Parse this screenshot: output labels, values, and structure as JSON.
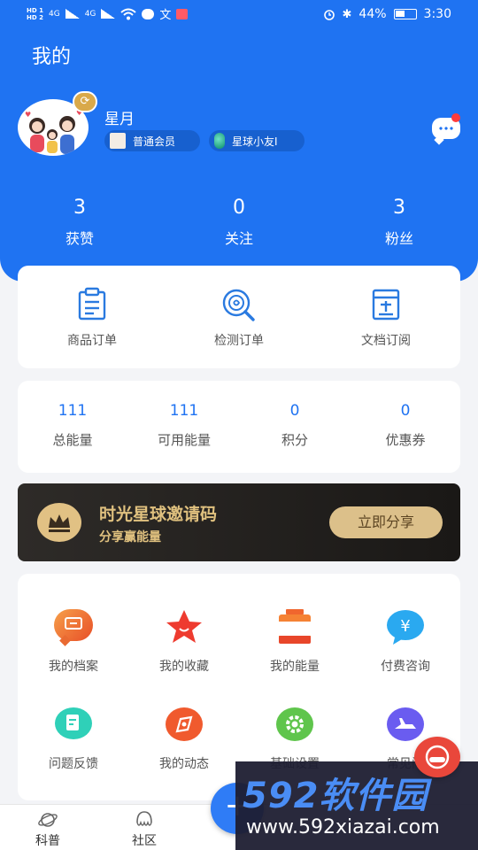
{
  "status_bar": {
    "hd1": "HD 1",
    "hd2": "HD 2",
    "net1": "4G",
    "net2": "4G",
    "battery": "44%",
    "time": "3:30"
  },
  "header": {
    "title": "我的"
  },
  "profile": {
    "name": "星月",
    "tags": [
      {
        "label": "普通会员"
      },
      {
        "label": "星球小友I"
      }
    ]
  },
  "stats": [
    {
      "value": "3",
      "label": "获赞"
    },
    {
      "value": "0",
      "label": "关注"
    },
    {
      "value": "3",
      "label": "粉丝"
    }
  ],
  "orders": [
    {
      "label": "商品订单",
      "icon": "clipboard-icon"
    },
    {
      "label": "检测订单",
      "icon": "magnifier-icon"
    },
    {
      "label": "文档订阅",
      "icon": "document-icon"
    }
  ],
  "energy": [
    {
      "value": "111",
      "label": "总能量"
    },
    {
      "value": "111",
      "label": "可用能量"
    },
    {
      "value": "0",
      "label": "积分"
    },
    {
      "value": "0",
      "label": "优惠券"
    }
  ],
  "invite": {
    "title": "时光星球邀请码",
    "subtitle": "分享赢能量",
    "button": "立即分享"
  },
  "grid": [
    {
      "label": "我的档案",
      "icon": "chat-bubble-icon",
      "color": "#ec6a2f"
    },
    {
      "label": "我的收藏",
      "icon": "star-icon",
      "color": "#ee3b2f"
    },
    {
      "label": "我的能量",
      "icon": "battery-icon",
      "color": "#f0662e"
    },
    {
      "label": "付费咨询",
      "icon": "yen-icon",
      "color": "#2aa9f0"
    },
    {
      "label": "问题反馈",
      "icon": "feedback-icon",
      "color": "#2fd0b8"
    },
    {
      "label": "我的动态",
      "icon": "compass-icon",
      "color": "#f05a2e"
    },
    {
      "label": "基础设置",
      "icon": "gear-icon",
      "color": "#5fc54c"
    },
    {
      "label": "常见问",
      "icon": "plane-icon",
      "color": "#6a5cf0"
    }
  ],
  "tabbar": [
    {
      "label": "科普"
    },
    {
      "label": "社区"
    }
  ],
  "fab": {
    "label": "+"
  },
  "watermark": {
    "title": "592软件园",
    "url": "www.592xiazai.com"
  }
}
